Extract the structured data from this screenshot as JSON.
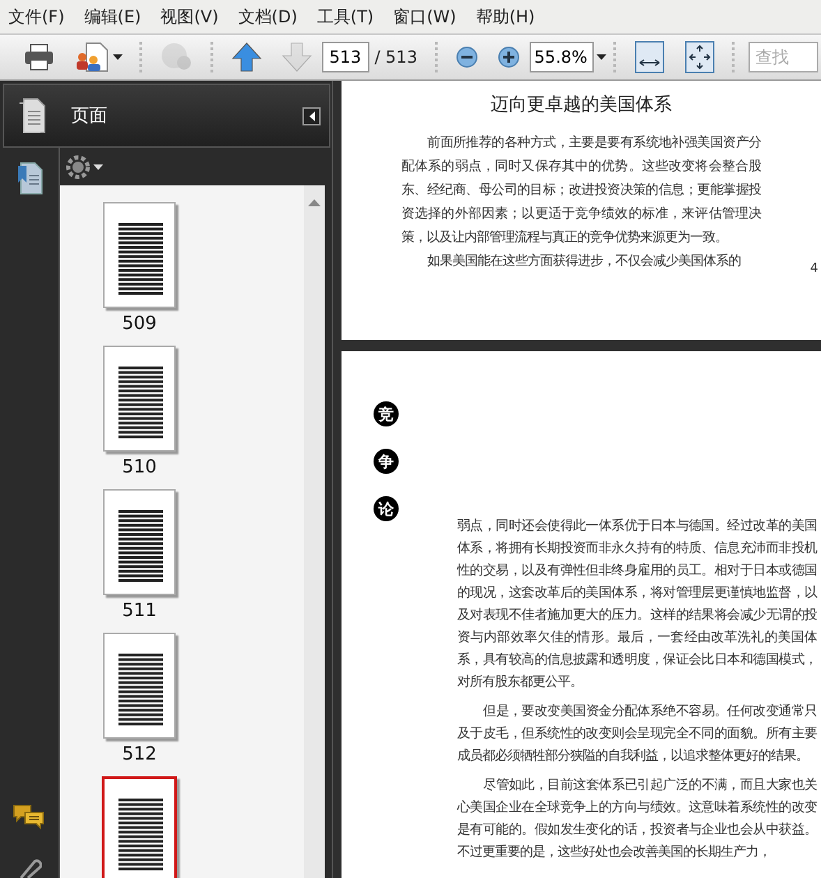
{
  "menu": [
    {
      "label": "文件(F)"
    },
    {
      "label": "编辑(E)"
    },
    {
      "label": "视图(V)"
    },
    {
      "label": "文档(D)"
    },
    {
      "label": "工具(T)"
    },
    {
      "label": "窗口(W)"
    },
    {
      "label": "帮助(H)"
    }
  ],
  "toolbar": {
    "tools": [
      {
        "kind": "print",
        "disabled": false
      },
      {
        "kind": "share",
        "disabled": false
      },
      {
        "kind": "globe",
        "disabled": true
      },
      {
        "kind": "previous",
        "disabled": false
      },
      {
        "kind": "next",
        "disabled": true
      }
    ],
    "page_field": {
      "value": "513"
    },
    "page_total": "/ 513",
    "zoom_field": {
      "value": "55.8%"
    },
    "search": {
      "placeholder": "查找"
    }
  },
  "sidebar": {
    "title": "页面",
    "thumbnails": [
      {
        "label": "509",
        "selected": false
      },
      {
        "label": "510",
        "selected": false
      },
      {
        "label": "511",
        "selected": false
      },
      {
        "label": "512",
        "selected": false
      },
      {
        "selected": true
      }
    ]
  },
  "document": {
    "pages": [
      {
        "title": "迈向更卓越的美国体系",
        "page_number": "4",
        "paragraphs": [
          {
            "indent": true,
            "text": "前面所推荐的各种方式，主要是要有系统地补强美国资产分配体系的弱点，同时又保存其中的优势。这些改变将会整合股东、经纪商、母公司的目标；改进投资决策的信息；更能掌握投资选择的外部因素；以更适于竞争绩效的标准，来评估管理决策，以及让内部管理流程与真正的竞争优势来源更为一致。"
          },
          {
            "indent": true,
            "text": "如果美国能在这些方面获得进步，不仅会减少美国体系的"
          }
        ]
      },
      {
        "side_marks": [
          "竞",
          "争",
          "论"
        ],
        "paragraphs": [
          {
            "indent": false,
            "text": "弱点，同时还会使得此一体系优于日本与德国。经过改革的美国体系，将拥有长期投资而非永久持有的特质、信息充沛而非投机性的交易，以及有弹性但非终身雇用的员工。相对于日本或德国的现况，这套改革后的美国体系，将对管理层更谨慎地监督，以及对表现不佳者施加更大的压力。这样的结果将会减少无谓的投资与内部效率欠佳的情形。最后，一套经由改革洗礼的美国体系，具有较高的信息披露和透明度，保证会比日本和德国模式，对所有股东都更公平。"
          },
          {
            "indent": true,
            "text": "但是，要改变美国资金分配体系绝不容易。任何改变通常只及于皮毛，但系统性的改变则会呈现完全不同的面貌。所有主要成员都必须牺牲部分狭隘的自我利益，以追求整体更好的结果。"
          },
          {
            "indent": true,
            "text": "尽管如此，目前这套体系已引起广泛的不满，而且大家也关心美国企业在全球竞争上的方向与绩效。这意味着系统性的改变是有可能的。假如发生变化的话，投资者与企业也会从中获益。不过更重要的是，这些好处也会改善美国的长期生产力，"
          }
        ]
      }
    ]
  }
}
